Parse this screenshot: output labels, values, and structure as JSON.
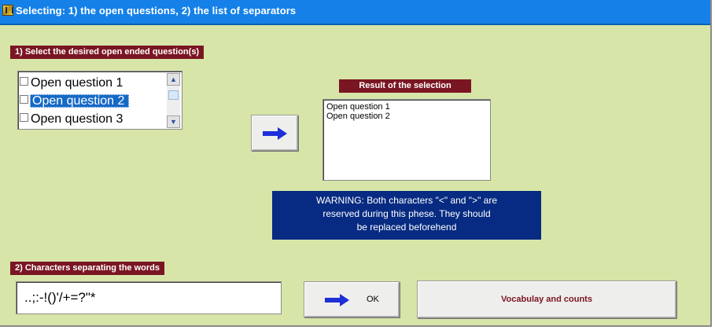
{
  "window": {
    "title": "Selecting: 1)  the open questions, 2) the list of separators"
  },
  "section1": {
    "label": "1)  Select the desired open ended question(s)",
    "questions": [
      {
        "label": "Open question 1",
        "selected": false
      },
      {
        "label": "Open question 2",
        "selected": true
      },
      {
        "label": "Open question 3",
        "selected": false
      }
    ]
  },
  "result": {
    "label": "Result of the selection",
    "items": [
      "Open question 1",
      "Open question 2"
    ]
  },
  "warning": {
    "lines": [
      "WARNING:    Both characters  \"<\"  and  \">\" are",
      "reserved during this phese. They should",
      "be replaced beforehend"
    ]
  },
  "section2": {
    "label": "2)   Characters separating the words",
    "separators_value": "..;:-!()'/+=?\"*"
  },
  "buttons": {
    "ok_label": "OK",
    "vocab_label": "Vocabulay and counts"
  },
  "colors": {
    "background": "#d7e5a8",
    "titlebar": "#1581e8",
    "section_label": "#7a1522",
    "warning_bg": "#072b82",
    "arrow": "#1d2fd8",
    "selection": "#1669c5"
  },
  "icons": {
    "app": "app-icon",
    "transfer": "right-arrow-icon",
    "ok": "right-arrow-icon",
    "scroll_up": "chevron-up-icon",
    "scroll_down": "chevron-down-icon",
    "checkbox": "checkbox-icon"
  }
}
